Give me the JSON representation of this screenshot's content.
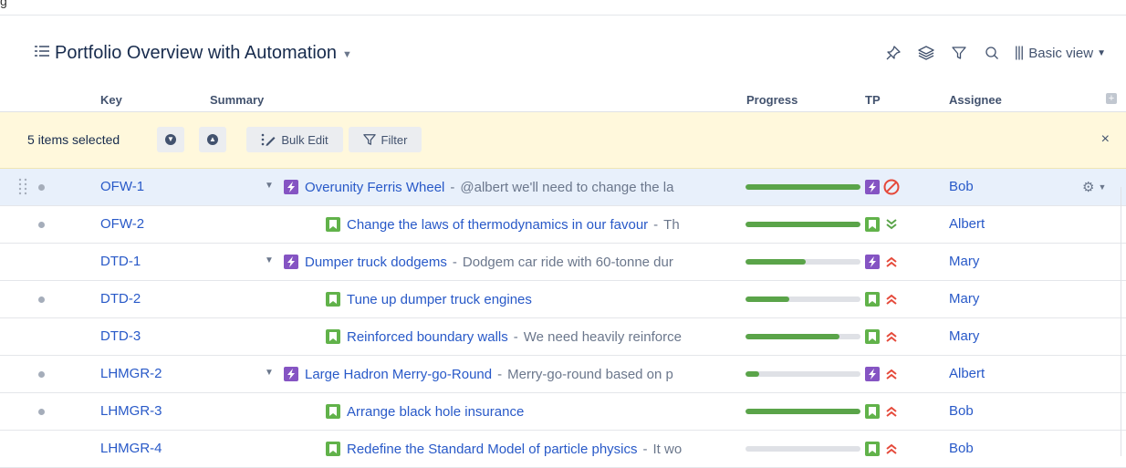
{
  "page": {
    "title": "Portfolio Overview with Automation",
    "view_label": "Basic view",
    "top_stub_text": "g"
  },
  "columns": {
    "key": "Key",
    "summary": "Summary",
    "progress": "Progress",
    "tp": "TP",
    "assignee": "Assignee"
  },
  "selection": {
    "count_label": "5 items selected",
    "bulk_edit_label": "Bulk Edit",
    "filter_label": "Filter",
    "close_label": "×"
  },
  "icons": {
    "title": "list-icon",
    "pin": "pin-icon",
    "layers": "layers-icon",
    "filter": "filter-icon",
    "search": "search-icon",
    "view": "columns-icon",
    "epic": "epic-bolt-icon",
    "story": "story-bookmark-icon"
  },
  "colors": {
    "epic": "#8554c3",
    "story": "#61b24a",
    "link": "#2859c8",
    "progress_fill": "#5aa449",
    "selection_bar": "#fff8dc",
    "selected_row": "#e8f0fb",
    "priority_high": "#e5493a",
    "priority_low": "#5aa449"
  },
  "rows": [
    {
      "key": "OFW-1",
      "type": "epic",
      "level": 0,
      "expanded": true,
      "dot": true,
      "selected": true,
      "title": "Overunity Ferris Wheel",
      "desc": "@albert we'll need to change the la",
      "progress": 1.0,
      "priority": "blocker",
      "assignee": "Bob"
    },
    {
      "key": "OFW-2",
      "type": "story",
      "level": 1,
      "expanded": false,
      "dot": true,
      "selected": false,
      "title": "Change the laws of thermodynamics in our favour",
      "desc": "Th",
      "progress": 1.0,
      "priority": "lowest",
      "assignee": "Albert"
    },
    {
      "key": "DTD-1",
      "type": "epic",
      "level": 0,
      "expanded": true,
      "dot": false,
      "selected": false,
      "title": "Dumper truck dodgems",
      "desc": "Dodgem car ride with 60-tonne dur",
      "progress": 0.52,
      "priority": "highest",
      "assignee": "Mary"
    },
    {
      "key": "DTD-2",
      "type": "story",
      "level": 1,
      "expanded": false,
      "dot": true,
      "selected": false,
      "title": "Tune up dumper truck engines",
      "desc": "",
      "progress": 0.38,
      "priority": "highest",
      "assignee": "Mary"
    },
    {
      "key": "DTD-3",
      "type": "story",
      "level": 1,
      "expanded": false,
      "dot": false,
      "selected": false,
      "title": "Reinforced boundary walls",
      "desc": "We need heavily reinforce",
      "progress": 0.82,
      "priority": "highest",
      "assignee": "Mary"
    },
    {
      "key": "LHMGR-2",
      "type": "epic",
      "level": 0,
      "expanded": true,
      "dot": true,
      "selected": false,
      "title": "Large Hadron Merry-go-Round",
      "desc": "Merry-go-round based on p",
      "progress": 0.12,
      "priority": "highest",
      "assignee": "Albert"
    },
    {
      "key": "LHMGR-3",
      "type": "story",
      "level": 1,
      "expanded": false,
      "dot": true,
      "selected": false,
      "title": "Arrange black hole insurance",
      "desc": "",
      "progress": 1.0,
      "priority": "highest",
      "assignee": "Bob"
    },
    {
      "key": "LHMGR-4",
      "type": "story",
      "level": 1,
      "expanded": false,
      "dot": false,
      "selected": false,
      "title": "Redefine the Standard Model of particle physics",
      "desc": "It wo",
      "progress": 0.0,
      "priority": "highest",
      "assignee": "Bob"
    }
  ]
}
